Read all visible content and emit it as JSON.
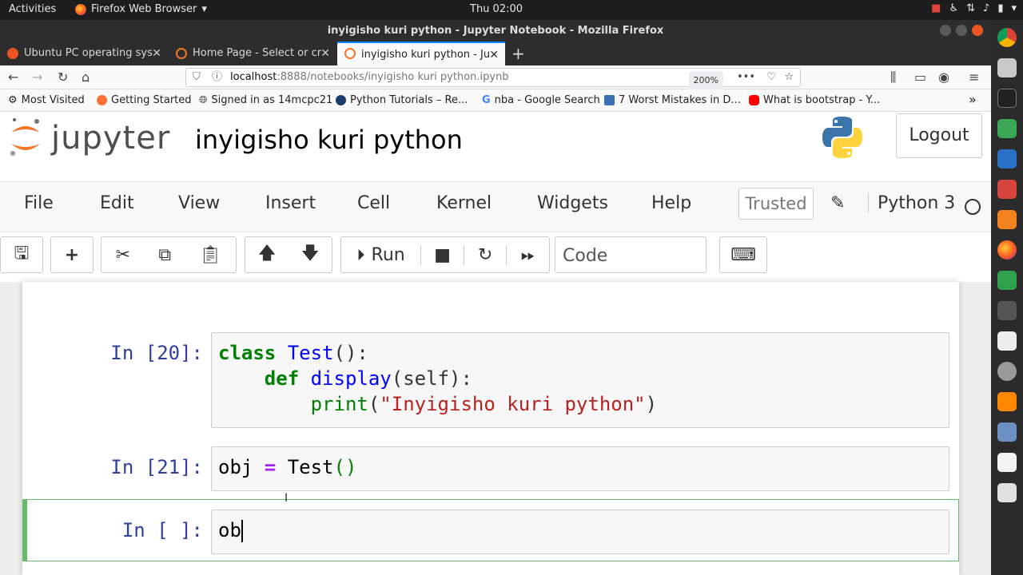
{
  "topbar": {
    "activities": "Activities",
    "app_name": "Firefox Web Browser",
    "clock": "Thu 02:00"
  },
  "window": {
    "title": "inyigisho kuri python - Jupyter Notebook - Mozilla Firefox"
  },
  "tabs": [
    {
      "label": "Ubuntu PC operating sys",
      "active": false
    },
    {
      "label": "Home Page - Select or cr",
      "active": false
    },
    {
      "label": "inyigisho kuri python - Ju",
      "active": true
    }
  ],
  "url": {
    "host": "localhost",
    "path": ":8888/notebooks/inyigisho kuri python.ipynb",
    "zoom": "200%"
  },
  "bookmarks": [
    {
      "label": "Most Visited",
      "icon": "gear-icon"
    },
    {
      "label": "Getting Started",
      "icon": "firefox-icon"
    },
    {
      "label": "Signed in as 14mcpc21",
      "icon": "globe-icon"
    },
    {
      "label": "Python Tutorials – Re...",
      "icon": "python-icon"
    },
    {
      "label": "nba - Google Search",
      "icon": "google-icon"
    },
    {
      "label": "7 Worst Mistakes in D...",
      "icon": "image-icon"
    },
    {
      "label": "What is bootstrap - Y...",
      "icon": "youtube-icon"
    }
  ],
  "jupyter": {
    "logo_text": "jupyter",
    "notebook_title": "inyigisho kuri python",
    "logout": "Logout",
    "menu": [
      "File",
      "Edit",
      "View",
      "Insert",
      "Cell",
      "Kernel",
      "Widgets",
      "Help"
    ],
    "trusted": "Trusted",
    "kernel": "Python 3",
    "run_label": "Run",
    "cell_type": "Code"
  },
  "cells": [
    {
      "prompt": "In [20]:"
    },
    {
      "prompt": "In [21]:"
    },
    {
      "prompt": "In [ ]:",
      "source": "ob"
    }
  ],
  "code": {
    "c1_class": "class",
    "c1_name": " Test",
    "c1_rest": "():",
    "c1_def": "def",
    "c1_fn": " display",
    "c1_args": "(self):",
    "c1_print": "print",
    "c1_open": "(",
    "c1_str": "\"Inyigisho kuri python\"",
    "c1_close": ")",
    "c2_var": "obj ",
    "c2_eq": "=",
    "c2_call": " Test",
    "c2_paren": "()"
  }
}
